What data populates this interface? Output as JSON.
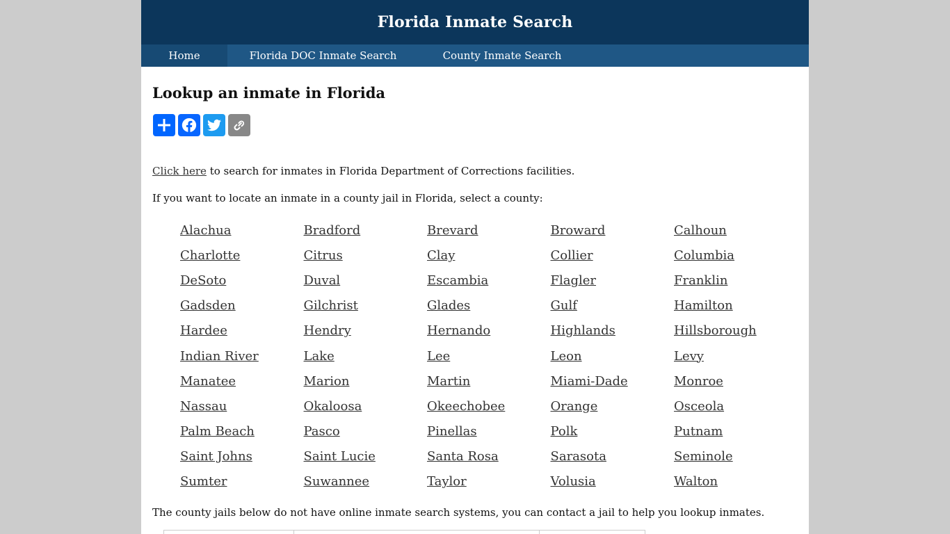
{
  "header": {
    "title": "Florida Inmate Search"
  },
  "nav": {
    "items": [
      {
        "label": "Home"
      },
      {
        "label": "Florida DOC Inmate Search"
      },
      {
        "label": "County Inmate Search"
      }
    ]
  },
  "main": {
    "heading": "Lookup an inmate in Florida",
    "share_buttons": [
      {
        "icon": "plus-icon",
        "color": "#0166ff"
      },
      {
        "icon": "facebook-icon",
        "color": "#0866ff"
      },
      {
        "icon": "twitter-icon",
        "color": "#1d9bf0"
      },
      {
        "icon": "link-icon",
        "color": "#888888"
      }
    ],
    "doc_link_text": "Click here",
    "doc_text": " to search for inmates in Florida Department of Corrections facilities.",
    "county_prompt": "If you want to locate an inmate in a county jail in Florida, select a county:",
    "counties": [
      "Alachua",
      "Bradford",
      "Brevard",
      "Broward",
      "Calhoun",
      "Charlotte",
      "Citrus",
      "Clay",
      "Collier",
      "Columbia",
      "DeSoto",
      "Duval",
      "Escambia",
      "Flagler",
      "Franklin",
      "Gadsden",
      "Gilchrist",
      "Glades",
      "Gulf",
      "Hamilton",
      "Hardee",
      "Hendry",
      "Hernando",
      "Highlands",
      "Hillsborough",
      "Indian River",
      "Lake",
      "Lee",
      "Leon",
      "Levy",
      "Manatee",
      "Marion",
      "Martin",
      "Miami-Dade",
      "Monroe",
      "Nassau",
      "Okaloosa",
      "Okeechobee",
      "Orange",
      "Osceola",
      "Palm Beach",
      "Pasco",
      "Pinellas",
      "Polk",
      "Putnam",
      "Saint Johns",
      "Saint Lucie",
      "Santa Rosa",
      "Sarasota",
      "Seminole",
      "Sumter",
      "Suwannee",
      "Taylor",
      "Volusia",
      "Walton"
    ],
    "no_online_text": "The county jails below do not have online inmate search systems, you can contact a jail to help you lookup inmates."
  },
  "colors": {
    "header_bg": "#0c365b",
    "nav_bg": "#1f5785",
    "nav_active_bg": "#174a74",
    "link": "#333333",
    "page_bg": "#cccccc"
  }
}
